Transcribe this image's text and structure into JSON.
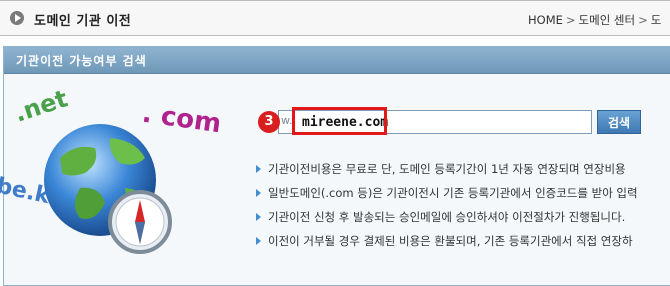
{
  "header": {
    "title": "도메인 기관 이전",
    "breadcrumb": [
      "HOME",
      "도메인 센터",
      "도"
    ]
  },
  "panel": {
    "title": "기관이전 가능여부 검색"
  },
  "decor": {
    "words": [
      ".net",
      ". com",
      "be.kr"
    ]
  },
  "search": {
    "badge": "3",
    "prefix": "w.",
    "value": "mireene.com",
    "button_label": "검색"
  },
  "notes": [
    "기관이전비용은 무료로 단, 도메인 등록기간이 1년 자동 연장되며 연장비용",
    "일반도메인(.com 등)은 기관이전시 기존 등록기관에서 인증코드를 받아 입력",
    "기관이전 신청 후 발송되는 승인메일에 승인하셔야 이전절차가 진행됩니다.",
    "이전이 거부될 경우 결제된 비용은 환불되며, 기존 등록기관에서 직접 연장하"
  ],
  "colors": {
    "panel_header": "#7fa6c5",
    "highlight": "#e21717",
    "button": "#4f8ac3"
  },
  "icons": [
    "play-circle-icon",
    "globe-icon",
    "compass-icon",
    "bullet-arrow-icon"
  ]
}
